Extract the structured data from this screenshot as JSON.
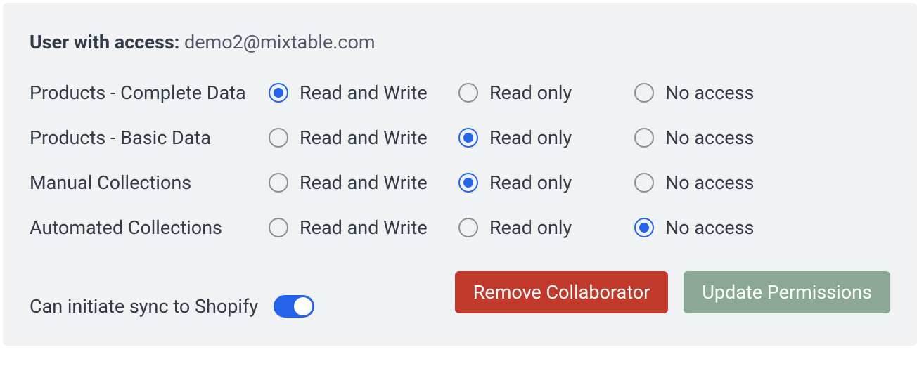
{
  "header": {
    "label": "User with access:",
    "email": "demo2@mixtable.com"
  },
  "options": {
    "rw": "Read and Write",
    "ro": "Read only",
    "na": "No access"
  },
  "permissions": [
    {
      "label": "Products - Complete Data",
      "selected": "rw"
    },
    {
      "label": "Products - Basic Data",
      "selected": "ro"
    },
    {
      "label": "Manual Collections",
      "selected": "ro"
    },
    {
      "label": "Automated Collections",
      "selected": "na"
    }
  ],
  "sync": {
    "label": "Can initiate sync to Shopify",
    "on": true
  },
  "buttons": {
    "remove": "Remove Collaborator",
    "update": "Update Permissions"
  }
}
